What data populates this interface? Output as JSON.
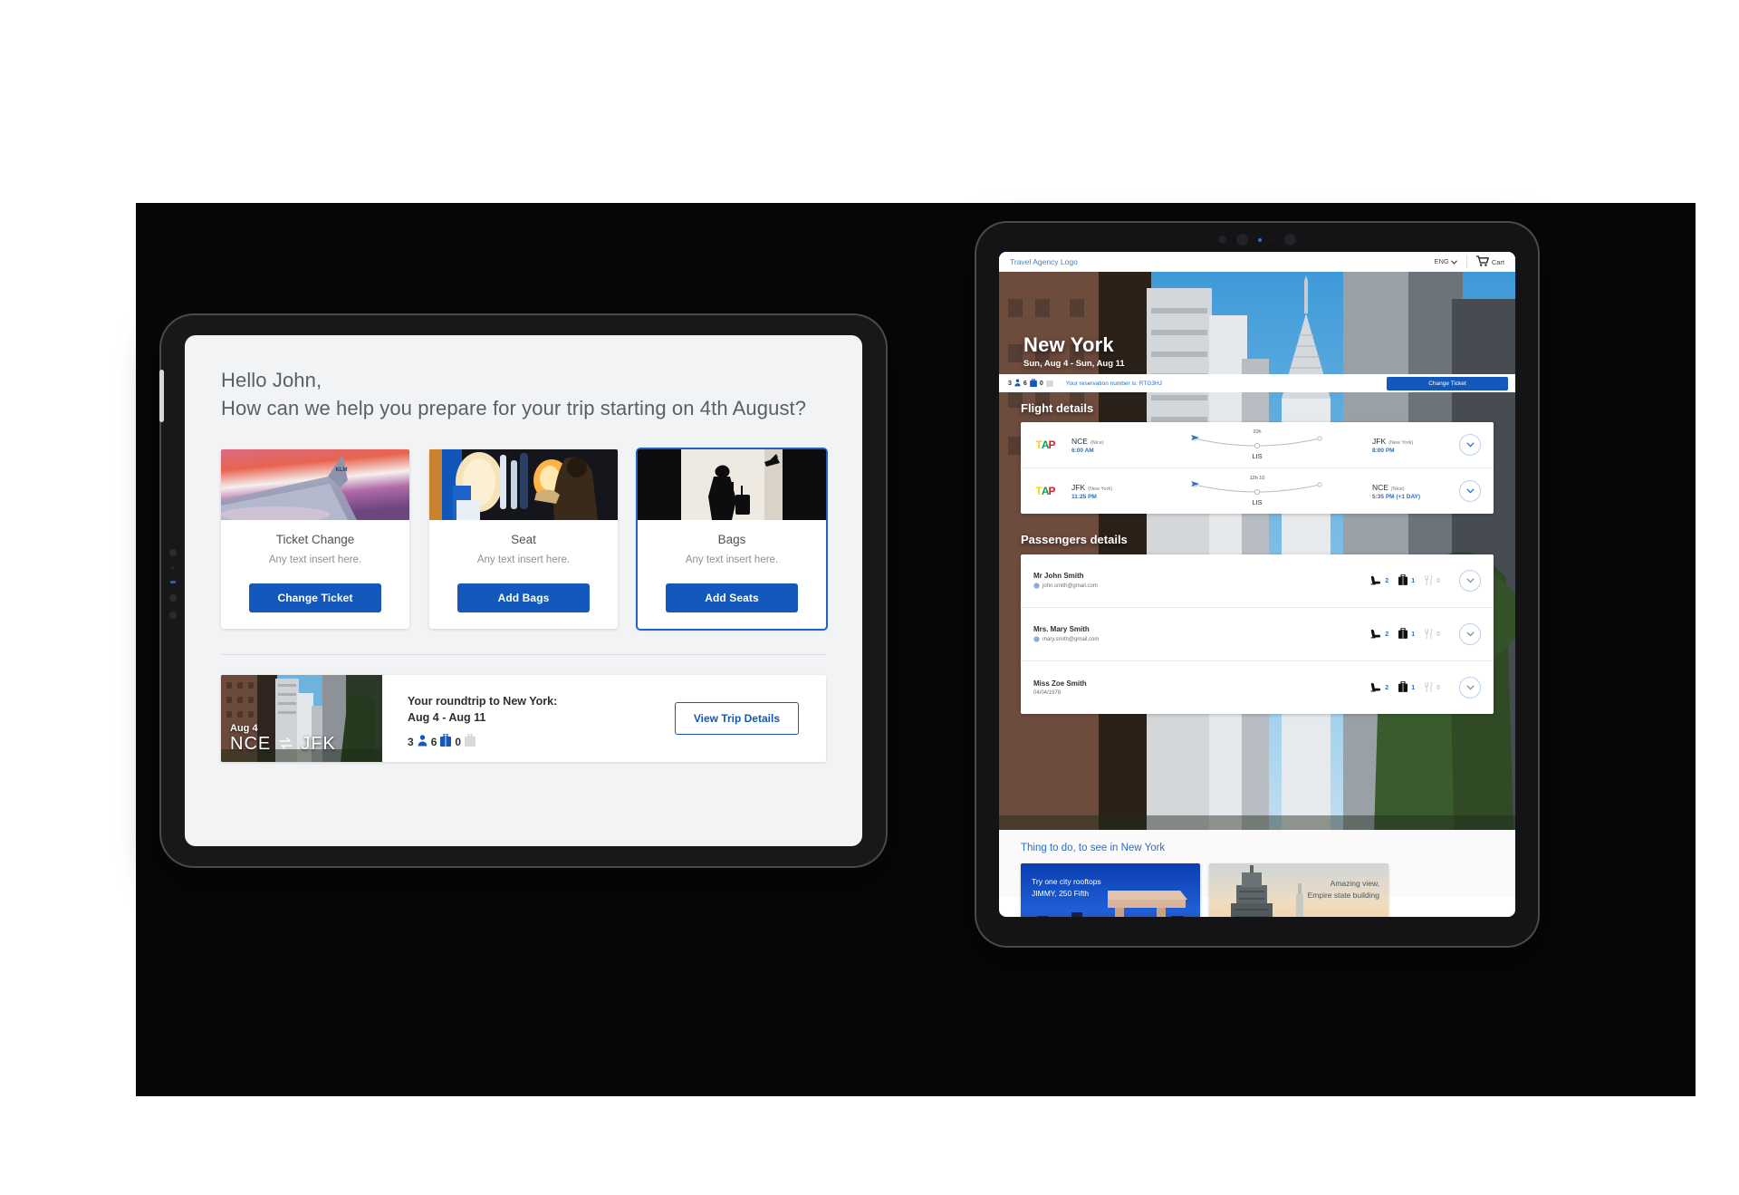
{
  "left_tablet": {
    "greeting_line1": "Hello John,",
    "greeting_line2": "How can we help you prepare for your trip starting on 4th August?",
    "cards": [
      {
        "title": "Ticket Change",
        "subtitle": "Any text insert here.",
        "button": "Change Ticket",
        "selected": false
      },
      {
        "title": "Seat",
        "subtitle": "Any text insert here.",
        "button": "Add Bags",
        "selected": false
      },
      {
        "title": "Bags",
        "subtitle": "Any text insert here.",
        "button": "Add Seats",
        "selected": true
      }
    ],
    "trip": {
      "date_badge": "Aug 4",
      "route_from": "NCE",
      "route_to": "JFK",
      "swap_icon": "swap-horizontal-icon",
      "title": "Your roundtrip to New York:",
      "dates": "Aug 4 - Aug 11",
      "passengers_count": "3",
      "bags_count": "6",
      "extra_count": "0",
      "button": "View Trip Details"
    }
  },
  "right_tablet": {
    "header": {
      "logo": "Travel Agency Logo",
      "language": "ENG",
      "language_chevron": "chevron-down-icon",
      "cart_icon": "cart-icon",
      "cart_label": "Cart"
    },
    "hero": {
      "city": "New York",
      "dates": "Sun, Aug 4 - Sun, Aug 11"
    },
    "reservation_bar": {
      "passengers_count": "3",
      "bags_count": "6",
      "extra_count": "0",
      "reservation_text": "Your reservation number is: RTG3HJ",
      "button": "Change Ticket"
    },
    "flight_section_title": "Flight details",
    "flights": [
      {
        "airline": "TAP",
        "from_code": "NCE",
        "from_city": "(Nice)",
        "depart": "6:00 AM",
        "duration": "20h",
        "stop": "LIS",
        "to_code": "JFK",
        "to_city": "(New York)",
        "arrive": "8:00 PM",
        "expand_icon": "chevron-down-icon"
      },
      {
        "airline": "TAP",
        "from_code": "JFK",
        "from_city": "(New York)",
        "depart": "11:25 PM",
        "duration": "12h 10",
        "stop": "LIS",
        "to_code": "NCE",
        "to_city": "(Nice)",
        "arrive": "5:35 PM (+1 DAY)",
        "expand_icon": "chevron-down-icon"
      }
    ],
    "passengers_section_title": "Passengers details",
    "passengers": [
      {
        "name": "Mr John Smith",
        "detail": "john.smith@gmail.com",
        "detail_icon": "mail-icon",
        "seats": "2",
        "bags": "1",
        "meals": "0",
        "expand_icon": "chevron-down-icon"
      },
      {
        "name": "Mrs. Mary Smith",
        "detail": "mary.smith@gmail.com",
        "detail_icon": "mail-icon",
        "seats": "2",
        "bags": "1",
        "meals": "0",
        "expand_icon": "chevron-down-icon"
      },
      {
        "name": "Miss Zoe Smith",
        "detail": "04/04/1978",
        "detail_icon": "none",
        "seats": "2",
        "bags": "1",
        "meals": "0",
        "expand_icon": "chevron-down-icon"
      }
    ],
    "todo": {
      "title": "Thing to do, to see in New York",
      "tiles": [
        {
          "line1": "Try one city rooftops",
          "line2": "JIMMY, 250 Fifth"
        },
        {
          "line1": "Amazing view,",
          "line2": "Empire state building"
        }
      ]
    }
  },
  "colors": {
    "primary_blue": "#1358ba",
    "link_blue": "#2a6ec4",
    "background_dark": "#070707",
    "screen_gray": "#f2f3f5"
  }
}
